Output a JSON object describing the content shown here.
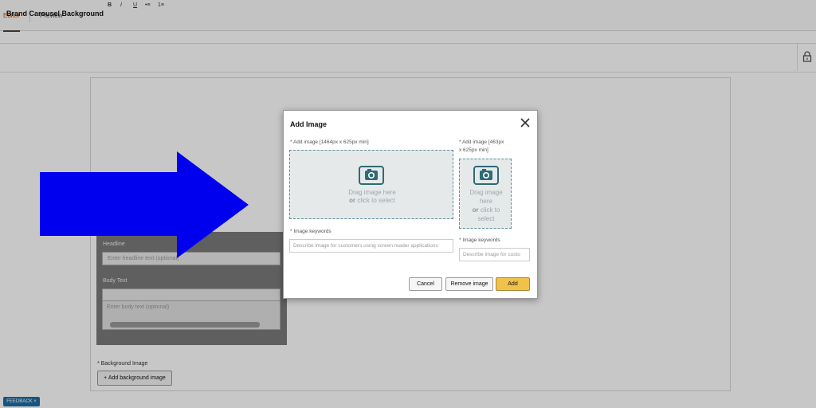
{
  "tabs": [
    {
      "label": "Editor",
      "active": true
    },
    {
      "label": "Preview",
      "active": false
    }
  ],
  "header": {
    "title": "Brand Carousel Background",
    "lock_icon": "lock-icon"
  },
  "text_card": {
    "headline_label": "Headline",
    "headline_placeholder": "Enter headline text (optional)",
    "body_label": "Body Text",
    "body_placeholder": "Enter body text (optional)",
    "toolbar": [
      "B",
      "I",
      "U",
      "•≡",
      "1≡"
    ]
  },
  "background": {
    "label": "* Background Image",
    "add_button": "+ Add background image"
  },
  "feedback": "FEEDBACK ×",
  "modal": {
    "title": "Add Image",
    "large": {
      "label": "* Add image [1464px x 625px min]",
      "drag_text": "Drag image here",
      "or_text": "or",
      "click_text": "click to select",
      "keywords_label": "* Image keywords",
      "keywords_placeholder": "Describe image for customers using screen reader applications"
    },
    "small": {
      "label_line1": "* Add image [463px",
      "label_line2": "x 625px min]",
      "drag_line1": "Drag image",
      "drag_line2": "here",
      "or_text": "or",
      "click_line1": "click to",
      "click_line2": "select",
      "keywords_label": "* Image keywords",
      "keywords_placeholder": "Describe image for custo"
    },
    "buttons": {
      "cancel": "Cancel",
      "remove": "Remove image",
      "add": "Add"
    }
  },
  "colors": {
    "arrow": "#0000ee",
    "accent_tab": "#c45500",
    "primary_button": "#f0c14b",
    "dropzone_border": "#5b8f97"
  }
}
